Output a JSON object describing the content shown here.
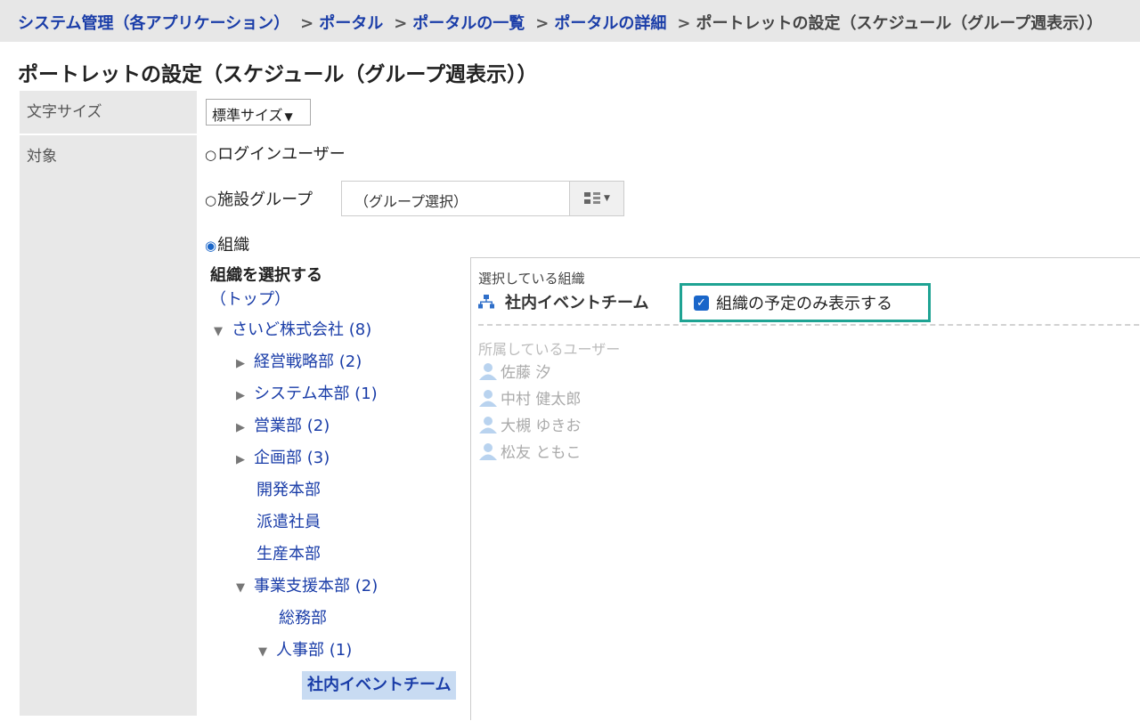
{
  "breadcrumb": {
    "items": [
      "システム管理（各アプリケーション）",
      "ポータル",
      "ポータルの一覧",
      "ポータルの詳細"
    ],
    "separator": ">",
    "current": "ポートレットの設定（スケジュール（グループ週表示））"
  },
  "page_title": "ポートレットの設定（スケジュール（グループ週表示））",
  "font_size": {
    "label": "文字サイズ",
    "selected": "標準サイズ"
  },
  "target": {
    "label": "対象",
    "options": {
      "login_user": "ログインユーザー",
      "facility_group": "施設グループ",
      "organization": "組織"
    },
    "selected": "organization",
    "group_select_placeholder": "（グループ選択）"
  },
  "tree": {
    "heading": "組織を選択する",
    "items": [
      "（トップ）",
      "さいど株式会社 (8)",
      "経営戦略部 (2)",
      "システム本部 (1)",
      "営業部 (2)",
      "企画部 (3)",
      "開発本部",
      "派遣社員",
      "生産本部",
      "事業支援本部 (2)",
      "総務部",
      "人事部 (1)",
      "社内イベントチーム"
    ]
  },
  "selected_panel": {
    "label": "選択している組織",
    "org_name": "社内イベントチーム",
    "only_org_checkbox_label": "組織の予定のみ表示する",
    "only_org_checked": true,
    "members_label": "所属しているユーザー",
    "members": [
      "佐藤 汐",
      "中村 健太郎",
      "大槻 ゆきお",
      "松友 ともこ"
    ]
  },
  "colors": {
    "link": "#1a3da8",
    "highlight_border": "#1fa393",
    "selected_bg": "#c8dbf2",
    "checkbox": "#1a66c9"
  }
}
